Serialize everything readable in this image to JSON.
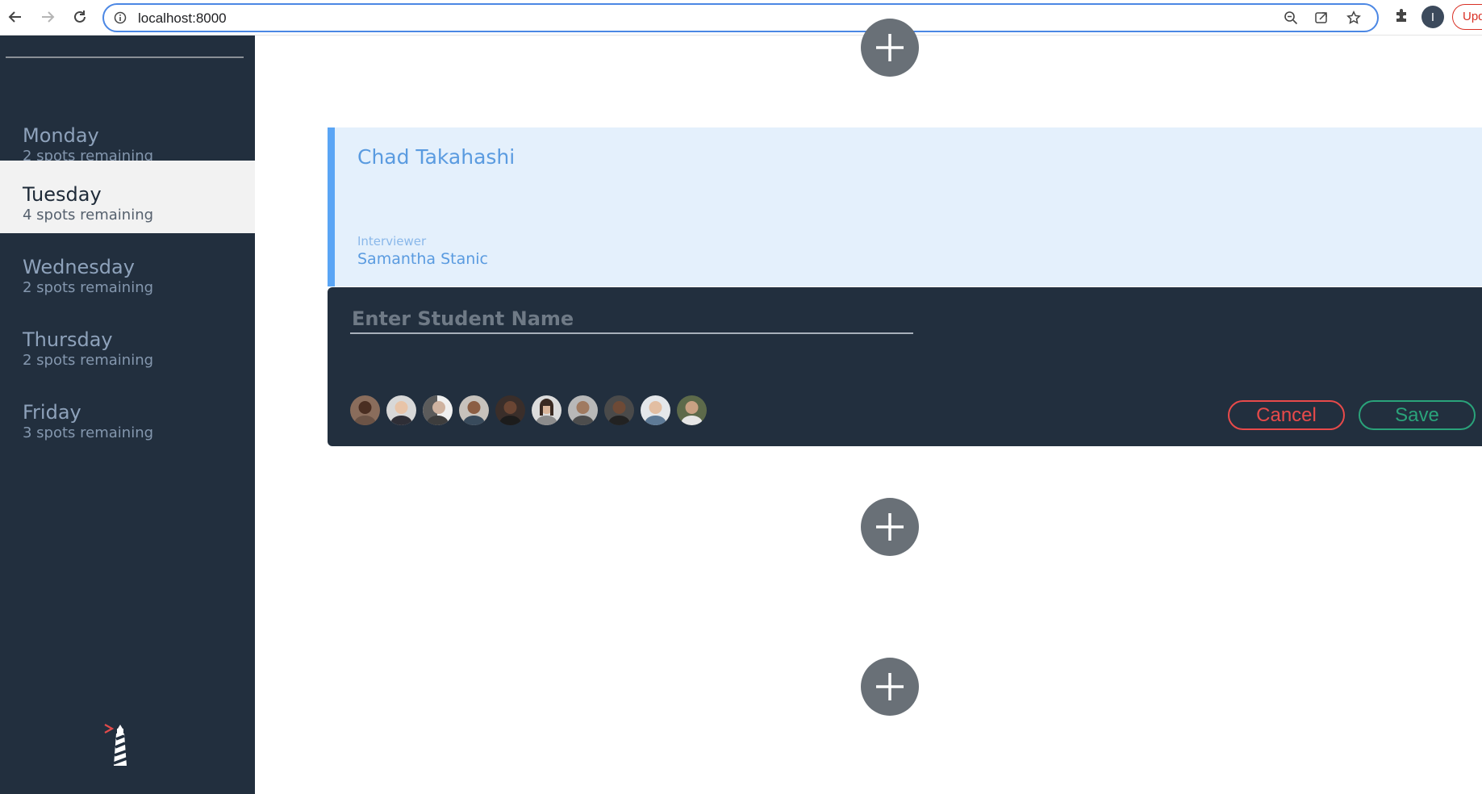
{
  "browser": {
    "url": "localhost:8000",
    "profile_initial": "I",
    "update_label": "Upd"
  },
  "sidebar": {
    "days": [
      {
        "name": "Monday",
        "spots": "2 spots remaining",
        "selected": false
      },
      {
        "name": "Tuesday",
        "spots": "4 spots remaining",
        "selected": true
      },
      {
        "name": "Wednesday",
        "spots": "2 spots remaining",
        "selected": false
      },
      {
        "name": "Thursday",
        "spots": "2 spots remaining",
        "selected": false
      },
      {
        "name": "Friday",
        "spots": "3 spots remaining",
        "selected": false
      }
    ]
  },
  "appointment": {
    "student": "Chad Takahashi",
    "interviewer_label": "Interviewer",
    "interviewer": "Samantha Stanic"
  },
  "form": {
    "placeholder": "Enter Student Name",
    "value": "",
    "cancel_label": "Cancel",
    "save_label": "Save",
    "interviewer_avatar_count": 10
  },
  "colors": {
    "sidebar_bg": "#222f3e",
    "selected_day_bg": "#f2f2f2",
    "appointment_bg": "#e4f0fc",
    "appointment_accent": "#5aa5f5",
    "add_button": "#697077",
    "cancel": "#e84a4a",
    "save": "#2aa37a"
  }
}
